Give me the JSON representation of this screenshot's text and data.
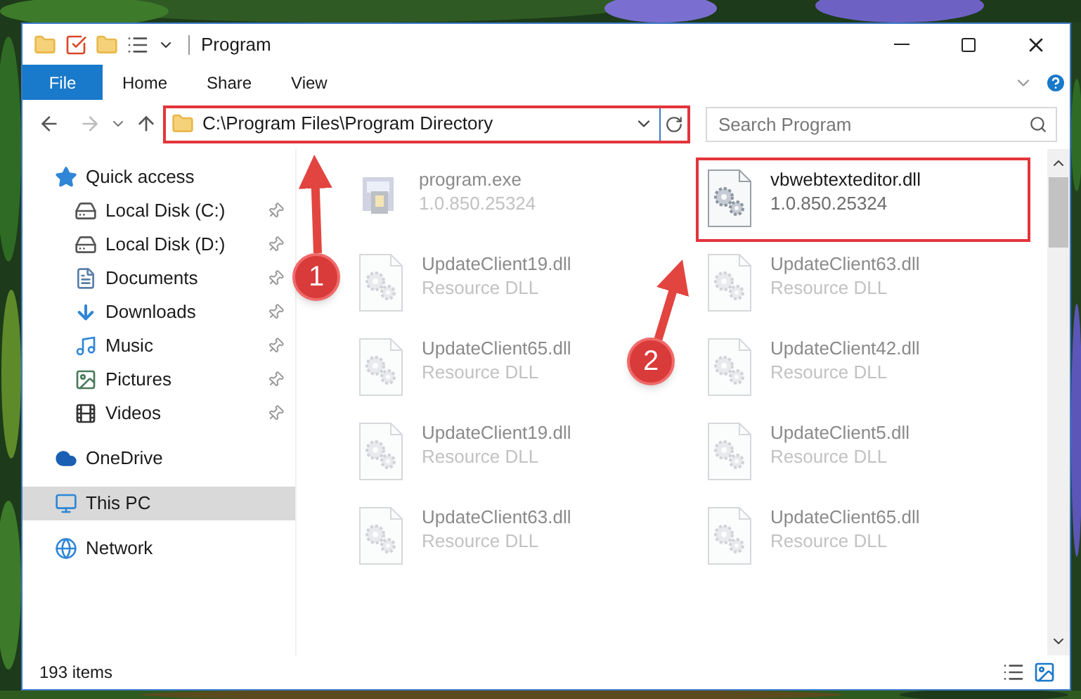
{
  "window": {
    "title": "Program"
  },
  "ribbon_tabs": [
    {
      "label": "File",
      "kind": "file"
    },
    {
      "label": "Home",
      "kind": "tab"
    },
    {
      "label": "Share",
      "kind": "tab"
    },
    {
      "label": "View",
      "kind": "tab"
    }
  ],
  "address_bar": {
    "path": "C:\\Program Files\\Program Directory",
    "highlighted": true
  },
  "search": {
    "placeholder": "Search Program"
  },
  "nav": [
    {
      "label": "Quick access",
      "kind": "star",
      "selected": false,
      "children": [
        {
          "label": "Local Disk (C:)",
          "kind": "drive-c",
          "pinned": true
        },
        {
          "label": "Local Disk (D:)",
          "kind": "drive",
          "pinned": true
        },
        {
          "label": "Documents",
          "kind": "documents",
          "pinned": true
        },
        {
          "label": "Downloads",
          "kind": "downloads",
          "pinned": true
        },
        {
          "label": "Music",
          "kind": "music",
          "pinned": true
        },
        {
          "label": "Pictures",
          "kind": "pictures",
          "pinned": true
        },
        {
          "label": "Videos",
          "kind": "videos",
          "pinned": true
        }
      ]
    },
    {
      "label": "OneDrive",
      "kind": "cloud",
      "selected": false
    },
    {
      "label": "This PC",
      "kind": "pc",
      "selected": true
    },
    {
      "label": "Network",
      "kind": "network",
      "selected": false
    }
  ],
  "files": [
    {
      "name": "program.exe",
      "detail": "1.0.850.25324",
      "kind": "exe",
      "blurred": true,
      "highlighted": false
    },
    {
      "name": "vbwebtexteditor.dll",
      "detail": "1.0.850.25324",
      "kind": "dll",
      "blurred": false,
      "highlighted": true
    },
    {
      "name": "UpdateClient19.dll",
      "detail": "Resource DLL",
      "kind": "dll",
      "blurred": true,
      "highlighted": false
    },
    {
      "name": "UpdateClient63.dll",
      "detail": "Resource DLL",
      "kind": "dll",
      "blurred": true,
      "highlighted": false
    },
    {
      "name": "UpdateClient65.dll",
      "detail": "Resource DLL",
      "kind": "dll",
      "blurred": true,
      "highlighted": false
    },
    {
      "name": "UpdateClient42.dll",
      "detail": "Resource DLL",
      "kind": "dll",
      "blurred": true,
      "highlighted": false
    },
    {
      "name": "UpdateClient19.dll",
      "detail": "Resource DLL",
      "kind": "dll",
      "blurred": true,
      "highlighted": false
    },
    {
      "name": "UpdateClient5.dll",
      "detail": "Resource DLL",
      "kind": "dll",
      "blurred": true,
      "highlighted": false
    },
    {
      "name": "UpdateClient63.dll",
      "detail": "Resource DLL",
      "kind": "dll",
      "blurred": true,
      "highlighted": false
    },
    {
      "name": "UpdateClient65.dll",
      "detail": "Resource DLL",
      "kind": "dll",
      "blurred": true,
      "highlighted": false
    }
  ],
  "status_bar": {
    "item_count": "193 items"
  },
  "annotations": [
    {
      "label": "1"
    },
    {
      "label": "2"
    }
  ]
}
